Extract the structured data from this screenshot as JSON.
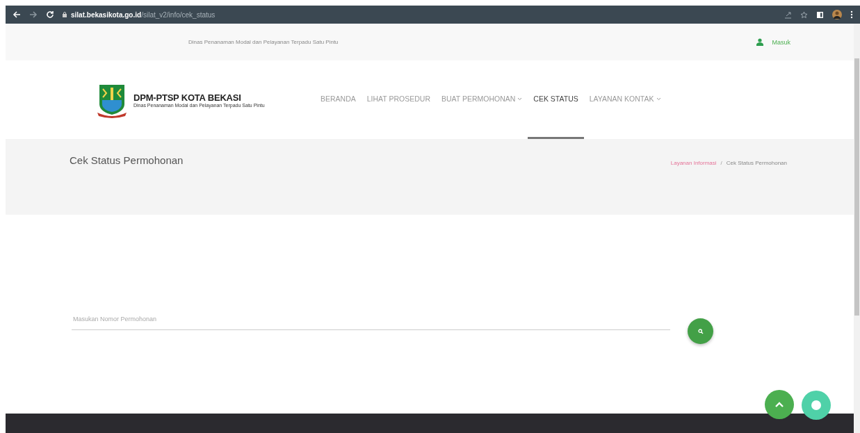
{
  "browser": {
    "url_domain": "silat.bekasikota.go.id",
    "url_path": "/silat_v2/info/cek_status"
  },
  "top_bar": {
    "agency": "Dinas Penanaman Modal dan Pelayanan Terpadu Satu Pintu",
    "login": "Masuk"
  },
  "brand": {
    "title": "DPM-PTSP KOTA BEKASI",
    "subtitle": "Dinas Penanaman Modal dan Pelayanan Terpadu Satu Pintu"
  },
  "nav": [
    {
      "label": "BERANDA",
      "selected": false,
      "dropdown": false
    },
    {
      "label": "LIHAT PROSEDUR",
      "selected": false,
      "dropdown": false
    },
    {
      "label": "BUAT PERMOHONAN",
      "selected": false,
      "dropdown": true
    },
    {
      "label": "CEK STATUS",
      "selected": true,
      "dropdown": false
    },
    {
      "label": "LAYANAN KONTAK",
      "selected": false,
      "dropdown": true
    }
  ],
  "page_title": "Cek Status Permohonan",
  "breadcrumb_separator": "/",
  "breadcrumbs": [
    {
      "label": "Layanan Informasi",
      "kind": "link"
    },
    {
      "label": "Cek Status Permohonan",
      "kind": "current"
    }
  ],
  "search": {
    "placeholder": "Masukan Nomor Permohonan"
  }
}
